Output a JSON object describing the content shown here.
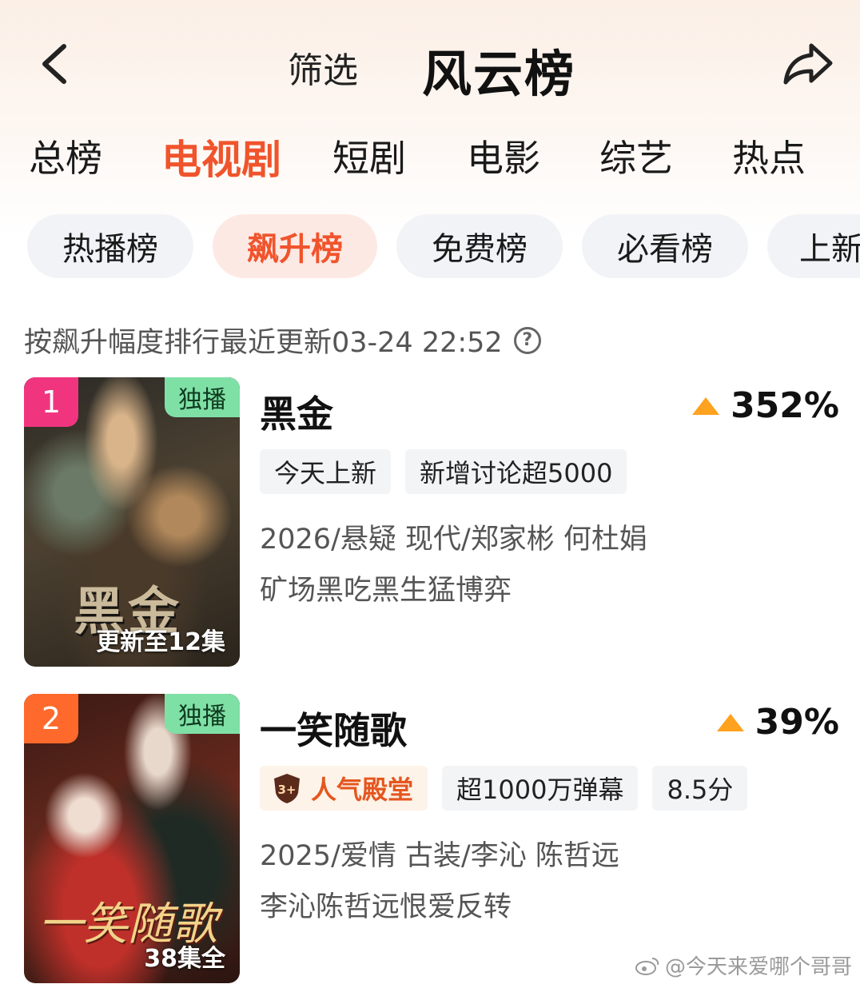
{
  "header": {
    "filter_label": "筛选",
    "title": "风云榜",
    "back_icon": "chevron-left-icon",
    "share_icon": "share-icon"
  },
  "category_tabs": [
    {
      "label": "总榜",
      "active": false
    },
    {
      "label": "电视剧",
      "active": true
    },
    {
      "label": "短剧",
      "active": false
    },
    {
      "label": "电影",
      "active": false
    },
    {
      "label": "综艺",
      "active": false
    },
    {
      "label": "热点",
      "active": false
    }
  ],
  "sub_tabs": [
    {
      "label": "热播榜",
      "active": false
    },
    {
      "label": "飙升榜",
      "active": true
    },
    {
      "label": "免费榜",
      "active": false
    },
    {
      "label": "必看榜",
      "active": false
    },
    {
      "label": "上新",
      "active": false
    }
  ],
  "update_text": "按飙升幅度排行最近更新03-24 22:52",
  "items": [
    {
      "rank": "1",
      "exclusive": "独播",
      "poster_title": "黑金",
      "episode_info": "更新至12集",
      "title": "黑金",
      "rise": "352%",
      "tags": [
        "今天上新",
        "新增讨论超5000"
      ],
      "meta": "2026/悬疑 现代/郑家彬 何杜娟",
      "desc": "矿场黑吃黑生猛博弈"
    },
    {
      "rank": "2",
      "exclusive": "独播",
      "poster_title": "一笑随歌",
      "episode_info": "38集全",
      "title": "一笑随歌",
      "rise": "39%",
      "hall_badge": "人气殿堂",
      "hall_badge_icon_text": "3+",
      "tags": [
        "超1000万弹幕",
        "8.5分"
      ],
      "meta": "2025/爱情 古装/李沁 陈哲远",
      "desc": "李沁陈哲远恨爱反转"
    }
  ],
  "watermark": "@今天来爱哪个哥哥",
  "colors": {
    "accent": "#f0542c",
    "rank1": "#f0357e",
    "rank2": "#ff6a2c",
    "exclusive_bg": "#7fe0a6",
    "rise_arrow": "#ffa21f"
  }
}
